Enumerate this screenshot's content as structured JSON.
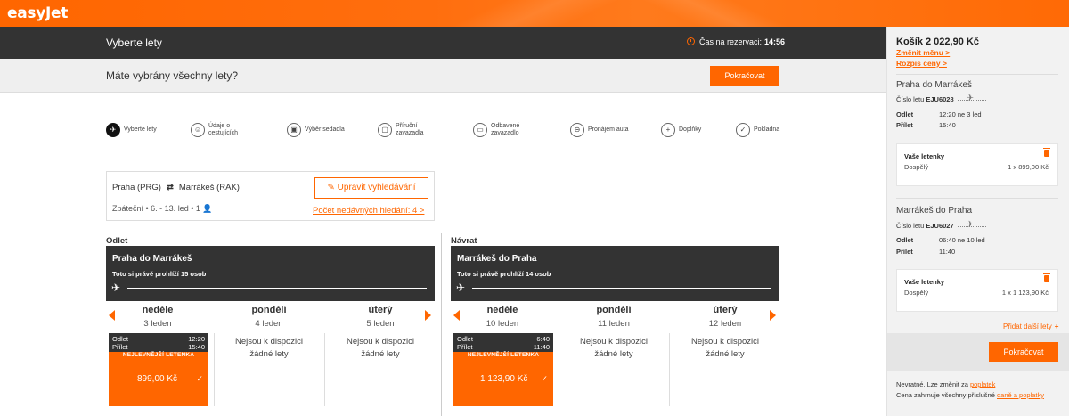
{
  "brand": {
    "logo": "easyJet",
    "accent": "#ff6600",
    "dark": "#333333"
  },
  "header": {
    "title": "Vyberte lety",
    "timer_label": "Čas na rezervaci:",
    "timer_value": "14:56",
    "question": "Máte vybrány všechny lety?",
    "continue_label": "Pokračovat"
  },
  "steps": [
    {
      "label": "Vyberte lety",
      "icon": "plane-icon",
      "active": true
    },
    {
      "label": "Údaje o cestujících",
      "icon": "passenger-icon"
    },
    {
      "label": "Výběr sedadla",
      "icon": "seat-icon"
    },
    {
      "label": "Příruční zavazadla",
      "icon": "cabin-bag-icon"
    },
    {
      "label": "Odbavené zavazadlo",
      "icon": "hold-bag-icon"
    },
    {
      "label": "Pronájem auta",
      "icon": "car-icon"
    },
    {
      "label": "Doplňky",
      "icon": "plus-icon"
    },
    {
      "label": "Pokladna",
      "icon": "checkout-icon"
    }
  ],
  "search": {
    "from": "Praha (PRG)",
    "to": "Marrákeš (RAK)",
    "trip": "Zpáteční • 6. - 13. led • 1",
    "edit_label": "Upravit vyhledávání",
    "recent_label": "Počet nedávných hledání: 4 >"
  },
  "outbound": {
    "section": "Odlet",
    "route": "Praha do Marrákeš",
    "viewers": "Toto si právě prohlíží 15 osob",
    "days": [
      {
        "name": "neděle",
        "date": "3 leden"
      },
      {
        "name": "pondělí",
        "date": "4 leden"
      },
      {
        "name": "úterý",
        "date": "5 leden"
      }
    ],
    "fare": {
      "dep_label": "Odlet",
      "dep_time": "12:20",
      "arr_label": "Přílet",
      "arr_time": "15:40",
      "badge": "NEJLEVNĚJŠÍ LETENKA",
      "price": "899,00 Kč"
    },
    "no_flights_1": "Nejsou k dispozici",
    "no_flights_2": "žádné lety"
  },
  "inbound": {
    "section": "Návrat",
    "route": "Marrákeš do Praha",
    "viewers": "Toto si právě prohlíží 14 osob",
    "days": [
      {
        "name": "neděle",
        "date": "10 leden"
      },
      {
        "name": "pondělí",
        "date": "11 leden"
      },
      {
        "name": "úterý",
        "date": "12 leden"
      }
    ],
    "fare": {
      "dep_label": "Odlet",
      "dep_time": "6:40",
      "arr_label": "Přílet",
      "arr_time": "11:40",
      "badge": "NEJLEVNĚJŠÍ LETENKA",
      "price": "1 123,90 Kč"
    },
    "no_flights_1": "Nejsou k dispozici",
    "no_flights_2": "žádné lety"
  },
  "cart": {
    "title": "Košík 2 022,90 Kč",
    "change_currency": "Změnit měnu >",
    "price_breakdown": "Rozpis ceny >",
    "segments": [
      {
        "title": "Praha do Marrákeš",
        "flight_label": "Číslo letu",
        "flight_no": "EJU6028",
        "dep_label": "Odlet",
        "dep_value": "12:20 ne 3 led",
        "arr_label": "Přílet",
        "arr_value": "15:40",
        "tickets_title": "Vaše letenky",
        "pax": "Dospělý",
        "amount": "1 x 899,00 Kč"
      },
      {
        "title": "Marrákeš do Praha",
        "flight_label": "Číslo letu",
        "flight_no": "EJU6027",
        "dep_label": "Odlet",
        "dep_value": "06:40 ne 10 led",
        "arr_label": "Přílet",
        "arr_value": "11:40",
        "tickets_title": "Vaše letenky",
        "pax": "Dospělý",
        "amount": "1 x 1 123,90 Kč"
      }
    ],
    "add_flights": "Přidat další lety",
    "continue_label": "Pokračovat",
    "note1_text": "Nevratné. Lze změnit za",
    "note1_link": "poplatek",
    "note2_text": "Cena zahrnuje všechny příslušné",
    "note2_link": "daně a poplatky"
  }
}
